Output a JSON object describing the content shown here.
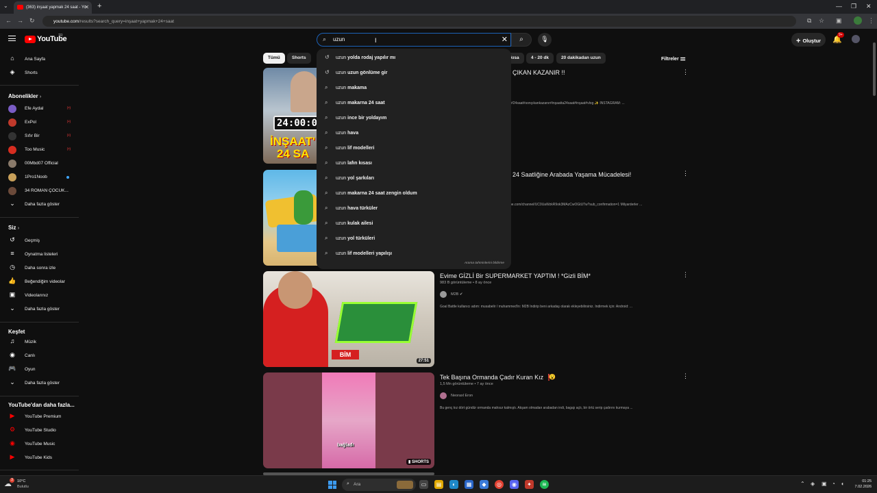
{
  "browser": {
    "tab_title": "(363) inşaat yapmak 24 saat - Yo",
    "url_host": "youtube.com",
    "url_path": "/results?search_query=inşaat+yapmak+24+saat"
  },
  "header": {
    "logo_text": "YouTube",
    "logo_region": "TR",
    "search_value": "uzun",
    "create_label": "Oluştur",
    "notif_count": "9+"
  },
  "sidebar": {
    "main": [
      {
        "label": "Ana Sayfa",
        "icon": "home-icon"
      },
      {
        "label": "Shorts",
        "icon": "shorts-icon"
      }
    ],
    "subs_head": "Abonelikler",
    "subs": [
      {
        "label": "Efe Aydal",
        "color": "#7a5cc4",
        "status": "live"
      },
      {
        "label": "ExPol",
        "color": "#c0392b",
        "status": "live"
      },
      {
        "label": "Sıfır Bir",
        "color": "#222222",
        "status": "live"
      },
      {
        "label": "Too Music",
        "color": "#d62d20",
        "status": "live"
      },
      {
        "label": "00Mbd07 Official",
        "color": "#8a7a6a",
        "status": ""
      },
      {
        "label": "1Pro1Noob",
        "color": "#c8a05a",
        "status": "dot"
      },
      {
        "label": "34 ROMAN ÇOCUK...",
        "color": "#6b4a3a",
        "status": ""
      }
    ],
    "subs_more": "Daha fazla göster",
    "you_head": "Siz",
    "you": [
      {
        "label": "Geçmiş",
        "icon": "history-icon"
      },
      {
        "label": "Oynatma listeleri",
        "icon": "playlist-icon"
      },
      {
        "label": "Daha sonra izle",
        "icon": "watch-later-icon"
      },
      {
        "label": "Beğendiğim videolar",
        "icon": "like-icon"
      },
      {
        "label": "Videolarınız",
        "icon": "your-videos-icon"
      },
      {
        "label": "Daha fazla göster",
        "icon": "chevron-down-icon"
      }
    ],
    "explore_head": "Keşfet",
    "explore": [
      {
        "label": "Müzik",
        "icon": "music-icon"
      },
      {
        "label": "Canlı",
        "icon": "live-icon"
      },
      {
        "label": "Oyun",
        "icon": "gaming-icon"
      },
      {
        "label": "Daha fazla göster",
        "icon": "chevron-down-icon"
      }
    ],
    "more_head": "YouTube'dan daha fazla...",
    "more": [
      {
        "label": "YouTube Premium"
      },
      {
        "label": "YouTube Studio"
      },
      {
        "label": "YouTube Music"
      },
      {
        "label": "YouTube Kids"
      }
    ],
    "live_badge": "(•)"
  },
  "chips": {
    "all": "Tümü",
    "shorts": "Shorts",
    "short": "kısa",
    "range": "4 - 20 dk",
    "long": "20 dakikadan uzun",
    "filters": "Filtreler"
  },
  "suggestions": {
    "prefix": "uzun",
    "items": [
      {
        "rest": " yolda rodaj yapılır mı",
        "history": true
      },
      {
        "rest": " uzun gönlüme gir",
        "history": true
      },
      {
        "rest": " makama",
        "history": false
      },
      {
        "rest": " makarna 24 saat",
        "history": false
      },
      {
        "rest": " ince bir yoldayım",
        "history": false
      },
      {
        "rest": " hava",
        "history": false
      },
      {
        "rest": " lif modelleri",
        "history": false
      },
      {
        "rest": " lafın kısası",
        "history": false
      },
      {
        "rest": " yol şarkıları",
        "history": false
      },
      {
        "rest": " makarna 24 saat zengin oldum",
        "history": false
      },
      {
        "rest": " hava türküler",
        "history": false
      },
      {
        "rest": " kulak ailesi",
        "history": false
      },
      {
        "rest": " yol türküleri",
        "history": false
      },
      {
        "rest": " lif modelleri yapılışı",
        "history": false
      }
    ],
    "footer": "Arama tahminlerini bildirme"
  },
  "results": [
    {
      "title_right": "ÇIKAN KAZANIR !!",
      "desc_right": "#24saat#sonçıkankazanır#inşaatta24saat#inşaat#vlog ✨ INSTAGRAM: ...",
      "thumb_text": "24:00:0",
      "thumb_text2": "İNŞAAT'",
      "thumb_text3": "24 SA"
    },
    {
      "title_right": "24 Saatliğine Arabada Yaşama Mücadelesi!",
      "desc_right": "be.com/channel/UC0UaWzkR9ok3MAzCwOGtUTw?sub_confirmation=1 Milyarderler ..."
    },
    {
      "title": "Evime GİZLİ Bir SUPERMARKET YAPTIM ! *Gizli BİM*",
      "views": "983 B görüntüleme",
      "age": "8 ay önce",
      "channel": "M2B",
      "desc": "Goal Battle kullanıcı adım: musabelir / muhammed'in: M2B İndirip beni arkadaş olarak ekleyebilirsiniz. İndirmek için: Android: ...",
      "duration": "27:51",
      "thumb_badge": "BİM"
    },
    {
      "title": "Tek Başına Ormanda Çadır Kuran Kız ❗",
      "views": "1,5 Mn görüntüleme",
      "age": "7 ay önce",
      "channel": "Neoraxl Eron",
      "desc": "Bu genç kız dört gündür ormanda mahsur kalmıştı. Akşam olmadan arabadan indi, bagajı açtı, bir örtü serip çadırını kurmaya ...",
      "duration": "SHORTS",
      "thumb_caption": "bağladı"
    }
  ],
  "taskbar": {
    "temp": "10°C",
    "cond": "Bulutlu",
    "weather_badge": "3",
    "search": "Ara",
    "time": "01:25",
    "date": "7.02.2026"
  }
}
